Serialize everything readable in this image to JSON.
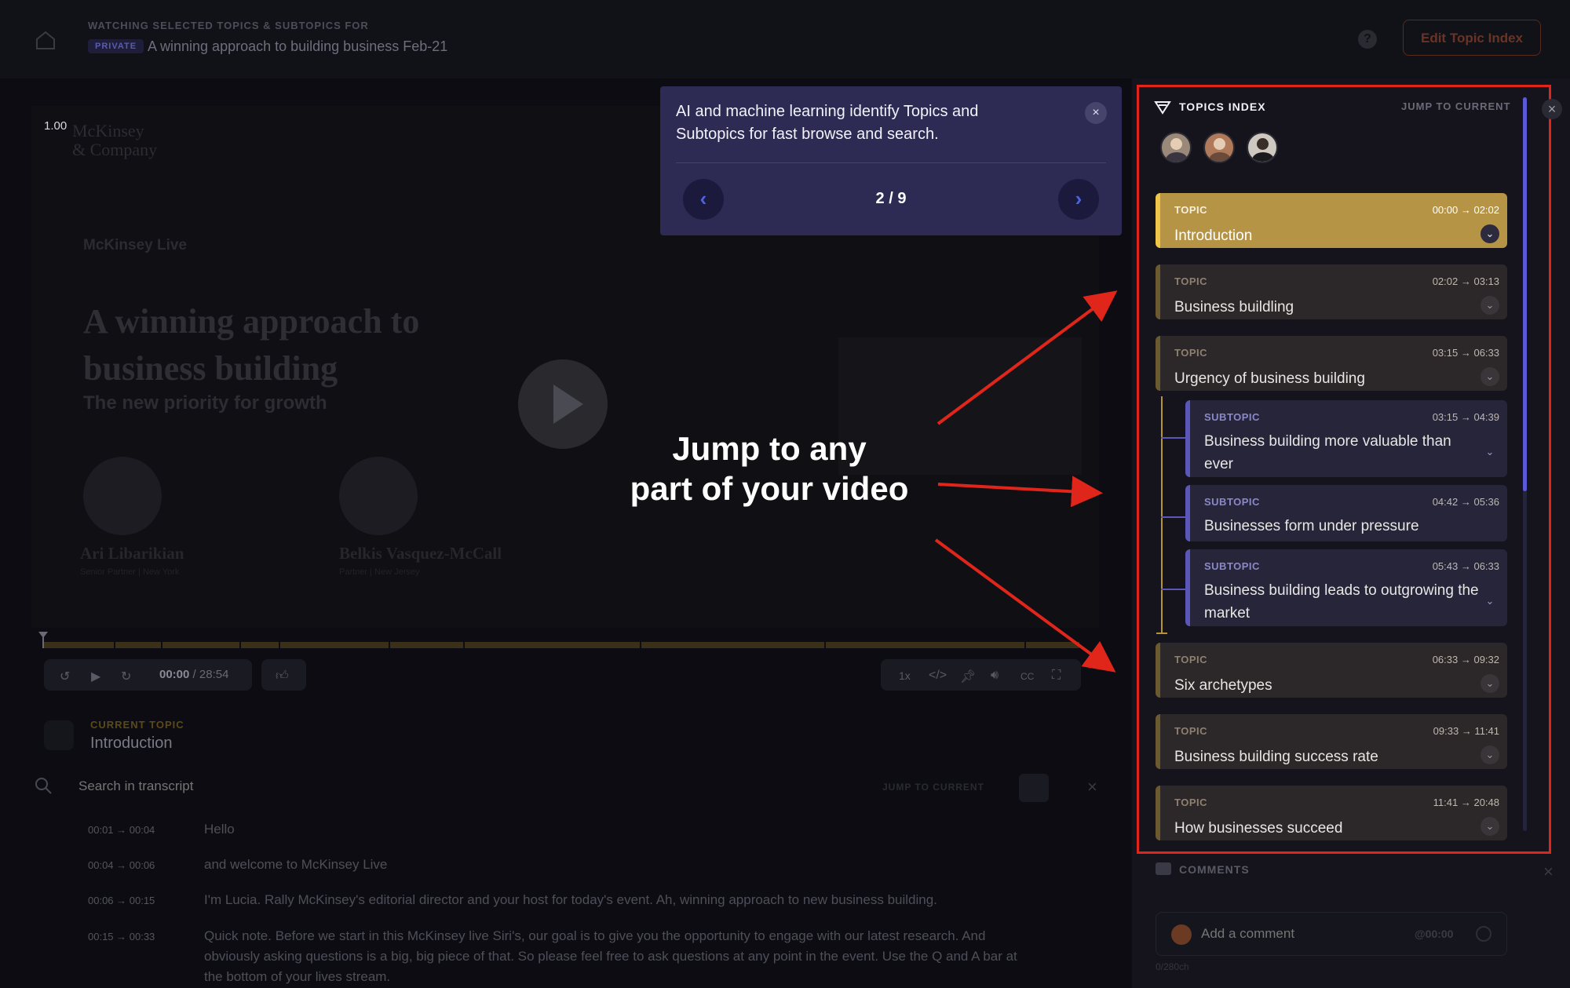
{
  "header": {
    "caption": "WATCHING SELECTED TOPICS & SUBTOPICS FOR",
    "badge": "PRIVATE",
    "title": "A winning approach to building business Feb-21",
    "help_icon": "question-icon",
    "edit_label": "Edit Topic Index"
  },
  "video": {
    "speed_tag": "1.00",
    "brand_line1": "McKinsey",
    "brand_line2": "& Company",
    "live": "McKinsey Live",
    "title": "A winning approach to business building",
    "subtitle": "The new priority for growth",
    "speakers": [
      {
        "name": "Ari Libarikian",
        "role": "Senior Partner | New York"
      },
      {
        "name": "Belkis Vasquez-McCall",
        "role": "Partner | New Jersey"
      }
    ],
    "progress": 0.0,
    "time_current": "00:00",
    "time_total": "/ 28:54",
    "speed_label": "1x"
  },
  "current_topic": {
    "caption": "CURRENT TOPIC",
    "name": "Introduction"
  },
  "transcript": {
    "search_placeholder": "Search in transcript",
    "jump_label": "JUMP TO CURRENT",
    "rows": [
      {
        "time": "00:01 → 00:04",
        "text": "Hello"
      },
      {
        "time": "00:04 → 00:06",
        "text": "and welcome to McKinsey Live"
      },
      {
        "time": "00:06 → 00:15",
        "text": "I'm Lucia. Rally McKinsey's editorial director and your host for today's event. Ah, winning approach to new business building."
      },
      {
        "time": "00:15 → 00:33",
        "text": "Quick note. Before we start in this McKinsey live Siri's, our goal is to give you the opportunity to engage with our latest research. And obviously asking questions is a big, big piece of that. So please feel free to ask questions at any point in the event. Use the Q and A bar at the bottom of your lives stream."
      }
    ]
  },
  "popover": {
    "text": "AI and machine learning identify Topics and Subtopics for fast browse and search.",
    "count": "2 / 9"
  },
  "overlay": {
    "line1": "Jump to any",
    "line2": "part of your video"
  },
  "topics_index": {
    "title": "TOPICS INDEX",
    "jump_label": "JUMP TO CURRENT",
    "items": [
      {
        "kind": "TOPIC",
        "time": "00:00 → 02:02",
        "title": "Introduction",
        "active": true
      },
      {
        "kind": "TOPIC",
        "time": "02:02 → 03:13",
        "title": "Business buildling"
      },
      {
        "kind": "TOPIC",
        "time": "03:15 → 06:33",
        "title": "Urgency of business building"
      },
      {
        "kind": "SUBTOPIC",
        "time": "03:15 → 04:39",
        "title": "Business building more valuable than ever"
      },
      {
        "kind": "SUBTOPIC",
        "time": "04:42 → 05:36",
        "title": "Businesses form under pressure"
      },
      {
        "kind": "SUBTOPIC",
        "time": "05:43 → 06:33",
        "title": "Business building leads to outgrowing the market"
      },
      {
        "kind": "TOPIC",
        "time": "06:33 → 09:32",
        "title": "Six archetypes"
      },
      {
        "kind": "TOPIC",
        "time": "09:33 → 11:41",
        "title": "Business building success rate"
      },
      {
        "kind": "TOPIC",
        "time": "11:41 → 20:48",
        "title": "How businesses succeed"
      }
    ]
  },
  "comments": {
    "title": "COMMENTS",
    "placeholder": "Add a comment",
    "time": "@00:00",
    "count": "0/280ch"
  },
  "colors": {
    "accent_red": "#e0251b",
    "active_topic": "#b69446",
    "popover_bg": "#2d2a54",
    "scroll_thumb": "#5a5ad8"
  }
}
